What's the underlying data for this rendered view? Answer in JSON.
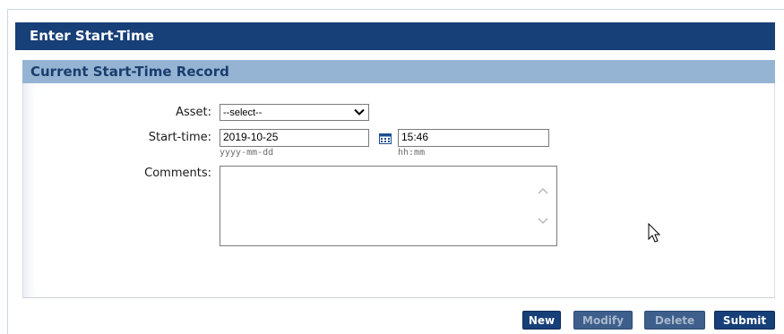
{
  "title_bar": {
    "title": "Enter Start-Time"
  },
  "section": {
    "title": "Current Start-Time Record"
  },
  "form": {
    "asset": {
      "label": "Asset:",
      "selected": "--select--"
    },
    "start_time": {
      "label": "Start-time:",
      "date_value": "2019-10-25",
      "date_hint": "yyyy-mm-dd",
      "time_value": "15:46",
      "time_hint": "hh:mm"
    },
    "comments": {
      "label": "Comments:",
      "value": ""
    }
  },
  "buttons": {
    "new": "New",
    "modify": "Modify",
    "delete": "Delete",
    "submit": "Submit"
  },
  "icons": {
    "calendar": "calendar-icon",
    "dropdown": "chevron-down-icon",
    "cursor": "mouse-pointer-icon"
  },
  "colors": {
    "title_bar": "#173f78",
    "section_bar": "#95b4d3",
    "button": "#173f78"
  }
}
